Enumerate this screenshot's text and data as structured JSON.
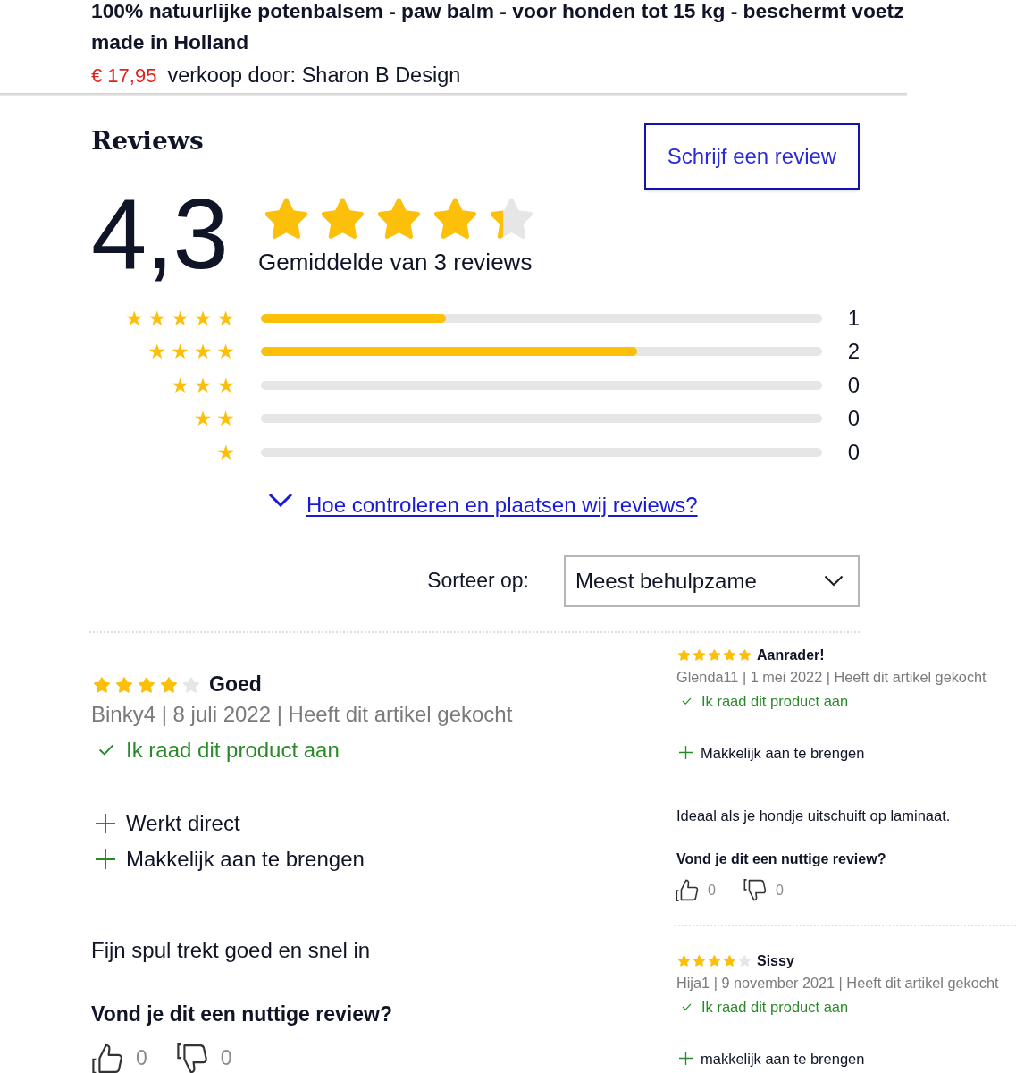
{
  "product": {
    "title_lines": [
      "100% natuurlijke potenbalsem - paw balm - voor honden tot 15 kg - beschermt voetz",
      "made in Holland"
    ],
    "price": "€ 17,95",
    "seller": "verkoop door: Sharon B Design"
  },
  "reviews_section": {
    "heading": "Reviews",
    "write_button": "Schrijf een review",
    "average": "4,3",
    "stars": 4.3,
    "summary": "Gemiddelde van 3 reviews",
    "distribution": [
      {
        "label": "★★★★★",
        "level": 0.33,
        "count": "1"
      },
      {
        "label": "★★★★",
        "level": 0.67,
        "count": "2"
      },
      {
        "label": "★★★",
        "level": 0,
        "count": "0"
      },
      {
        "label": "★★",
        "level": 0,
        "count": "0"
      },
      {
        "label": "★",
        "level": 0,
        "count": "0"
      }
    ],
    "policy_link": "Hoe controleren en plaatsen wij reviews?",
    "sort": {
      "label": "Sorteer op:",
      "value": "Meest behulpzame"
    }
  },
  "reviews": [
    {
      "stars": 4,
      "title": "Goed",
      "meta": "Binky4 | 8 juli 2022 | Heeft dit artikel gekocht",
      "recommendation": "Ik raad dit product aan",
      "pros": [
        "Werkt direct",
        "Makkelijk aan te brengen"
      ],
      "text": "Fijn spul trekt goed en snel in",
      "helpful_question": "Vond je dit een nuttige review?",
      "votes_up": "0",
      "votes_down": "0"
    },
    {
      "stars": 5,
      "title": "Aanrader!",
      "meta": "Glenda11 | 1 mei 2022 | Heeft dit artikel gekocht",
      "recommendation": "Ik raad dit product aan",
      "pros": [
        "Makkelijk aan te brengen"
      ],
      "text": "Ideaal als je hondje uitschuift op laminaat.",
      "helpful_question": "Vond je dit een nuttige review?",
      "votes_up": "0",
      "votes_down": "0"
    },
    {
      "stars": 4,
      "title": "Sissy",
      "meta": "Hija1 | 9 november 2021 | Heeft dit artikel gekocht",
      "recommendation": "Ik raad dit product aan",
      "pros": [
        "makkelijk aan te brengen"
      ]
    }
  ]
}
